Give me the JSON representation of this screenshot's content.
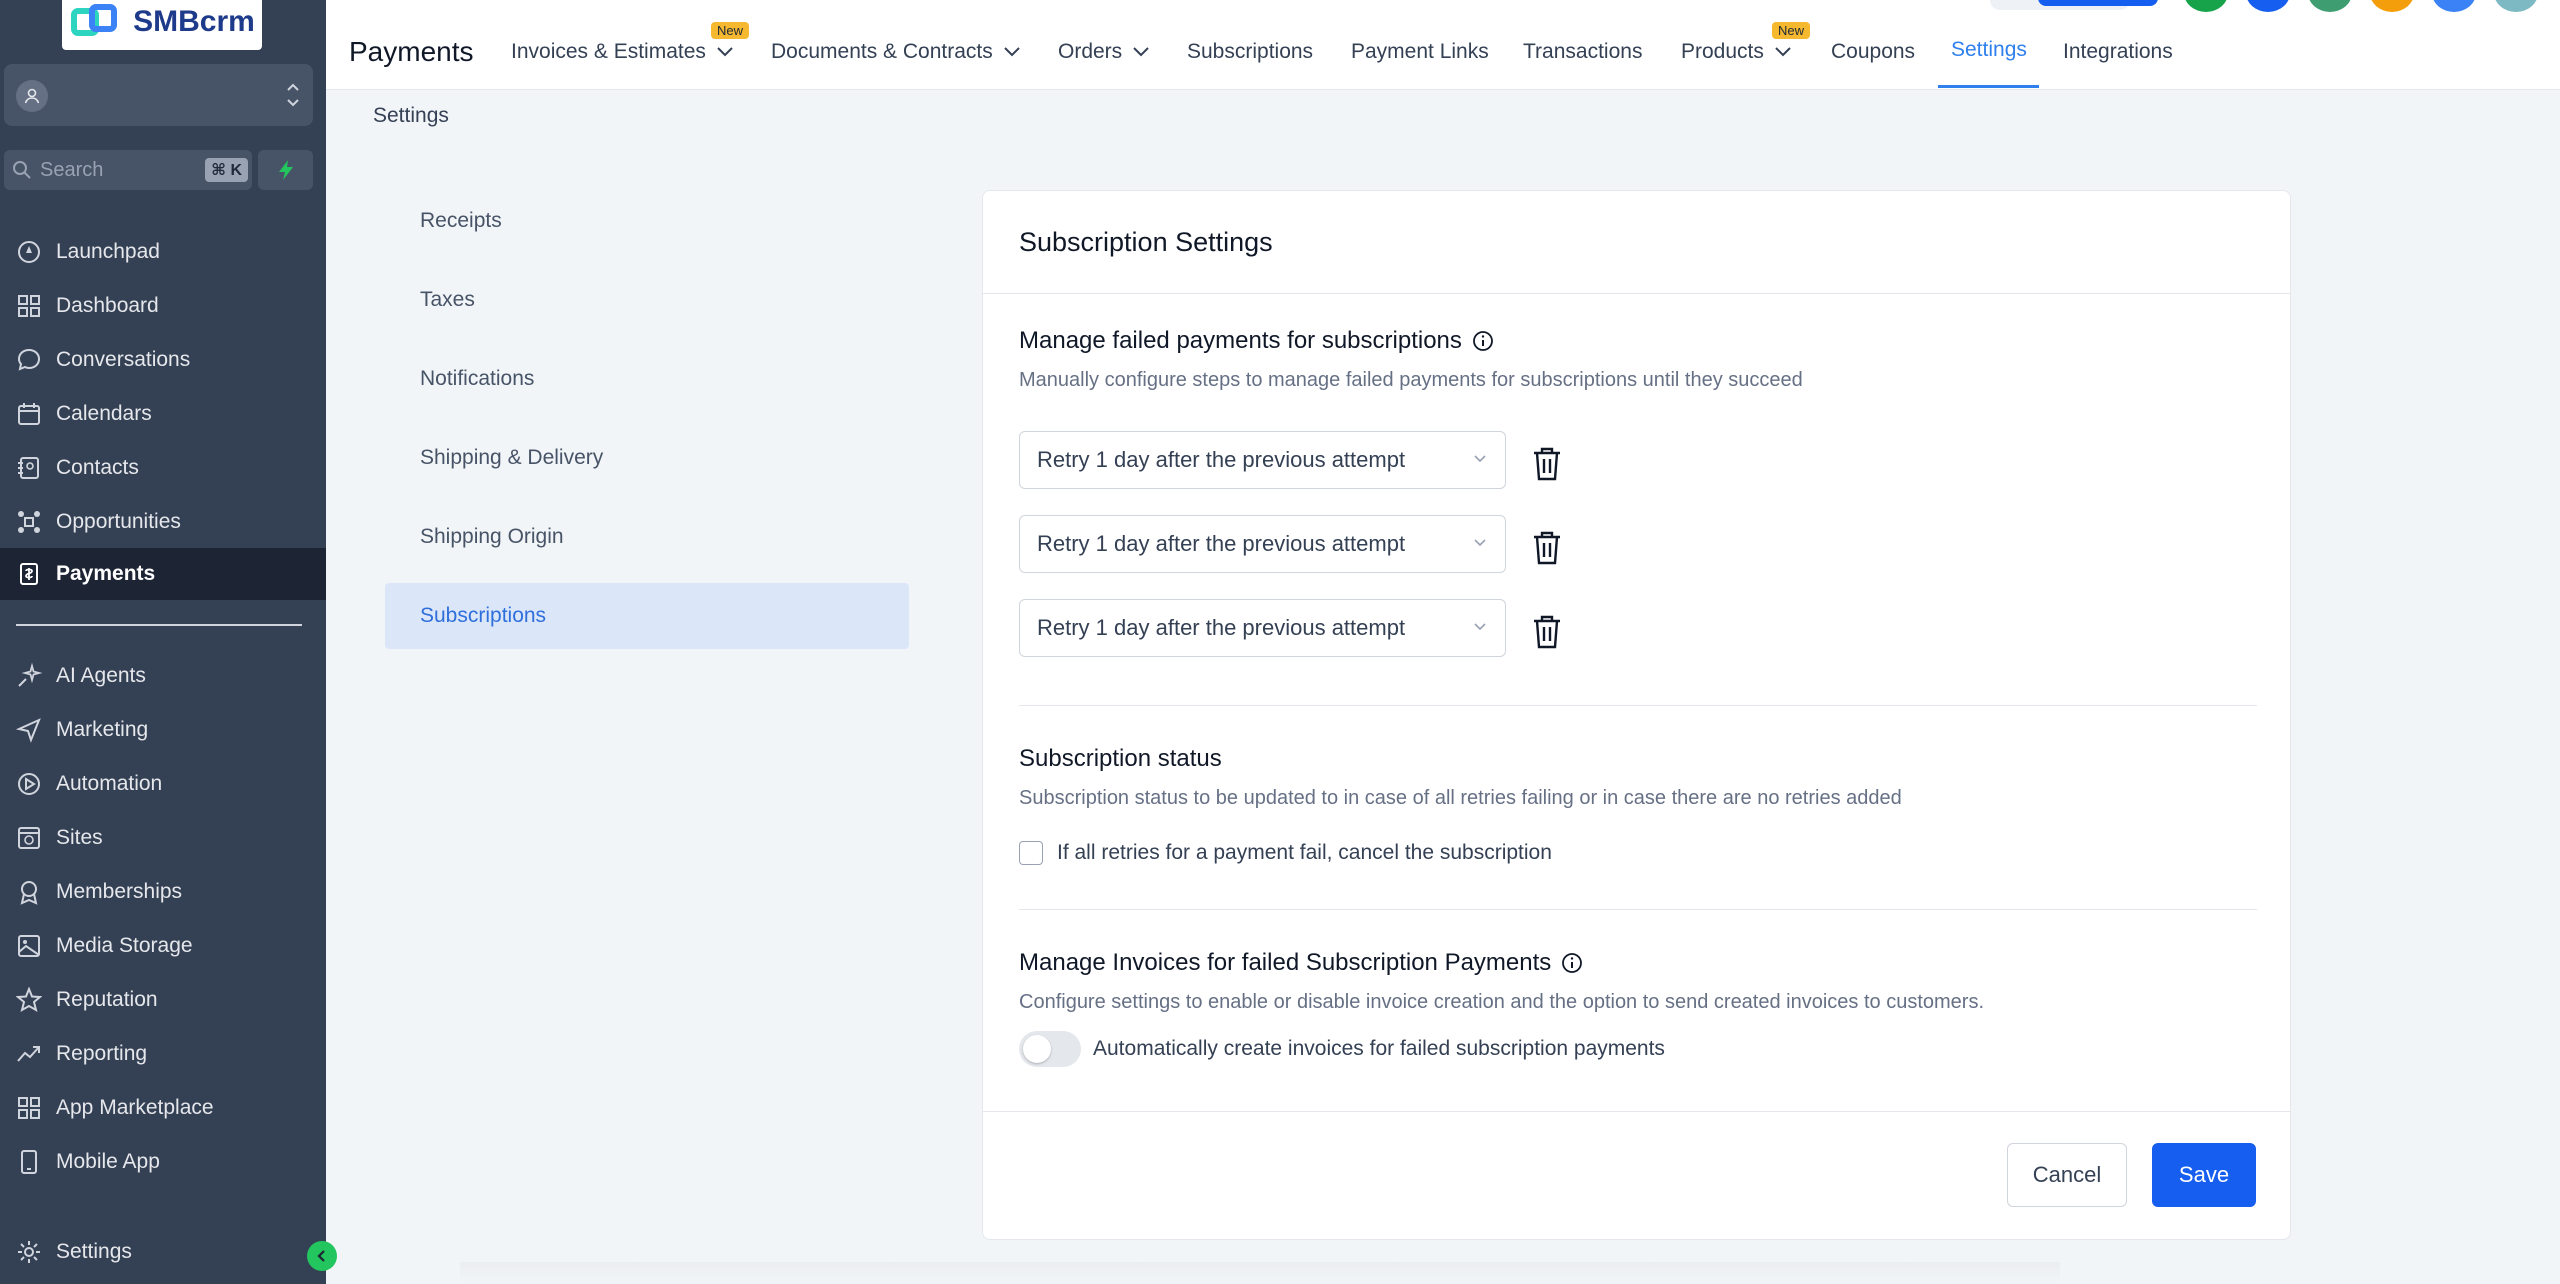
{
  "brand": {
    "name": "SMBcrm"
  },
  "sidebar": {
    "search_placeholder": "Search",
    "search_shortcut": "⌘ K",
    "items": [
      {
        "label": "Launchpad",
        "icon": "launchpad-icon"
      },
      {
        "label": "Dashboard",
        "icon": "dashboard-icon"
      },
      {
        "label": "Conversations",
        "icon": "chat-icon"
      },
      {
        "label": "Calendars",
        "icon": "calendar-icon"
      },
      {
        "label": "Contacts",
        "icon": "contacts-icon"
      },
      {
        "label": "Opportunities",
        "icon": "opportunities-icon"
      },
      {
        "label": "Payments",
        "icon": "payments-icon",
        "active": true
      }
    ],
    "items2": [
      {
        "label": "AI Agents",
        "icon": "ai-agents-icon"
      },
      {
        "label": "Marketing",
        "icon": "send-icon"
      },
      {
        "label": "Automation",
        "icon": "automation-icon"
      },
      {
        "label": "Sites",
        "icon": "sites-icon"
      },
      {
        "label": "Memberships",
        "icon": "badge-icon"
      },
      {
        "label": "Media Storage",
        "icon": "image-icon"
      },
      {
        "label": "Reputation",
        "icon": "star-icon"
      },
      {
        "label": "Reporting",
        "icon": "chart-line-icon"
      },
      {
        "label": "App Marketplace",
        "icon": "grid-icon"
      },
      {
        "label": "Mobile App",
        "icon": "phone-icon"
      }
    ],
    "settings_label": "Settings"
  },
  "header": {
    "title": "Payments",
    "tabs": [
      {
        "label": "Invoices & Estimates",
        "dropdown": true,
        "badge": "New"
      },
      {
        "label": "Documents & Contracts",
        "dropdown": true
      },
      {
        "label": "Orders",
        "dropdown": true
      },
      {
        "label": "Subscriptions"
      },
      {
        "label": "Payment Links"
      },
      {
        "label": "Transactions"
      },
      {
        "label": "Products",
        "dropdown": true,
        "badge": "New"
      },
      {
        "label": "Coupons"
      },
      {
        "label": "Settings",
        "active": true
      },
      {
        "label": "Integrations"
      }
    ]
  },
  "breadcrumb": "Settings",
  "settings_nav": [
    "Receipts",
    "Taxes",
    "Notifications",
    "Shipping & Delivery",
    "Shipping Origin",
    "Subscriptions"
  ],
  "card": {
    "title": "Subscription Settings",
    "failed_payments": {
      "title": "Manage failed payments for subscriptions",
      "description": "Manually configure steps to manage failed payments for subscriptions until they succeed",
      "retries": [
        "Retry 1 day after the previous attempt",
        "Retry 1 day after the previous attempt",
        "Retry 1 day after the previous attempt"
      ]
    },
    "status": {
      "title": "Subscription status",
      "description": "Subscription status to be updated to in case of all retries failing or in case there are no retries added",
      "checkbox_label": "If all retries for a payment fail, cancel the subscription",
      "checked": false
    },
    "invoices": {
      "title": "Manage Invoices for failed Subscription Payments",
      "description": "Configure settings to enable or disable invoice creation and the option to send created invoices to customers.",
      "toggle_label": "Automatically create invoices for failed subscription payments",
      "enabled": false
    },
    "cancel_label": "Cancel",
    "save_label": "Save"
  },
  "colors": {
    "sidebar_bg": "#344054",
    "accent": "#155eef",
    "active_tab": "#2f80ed",
    "badge": "#f5b82e"
  }
}
